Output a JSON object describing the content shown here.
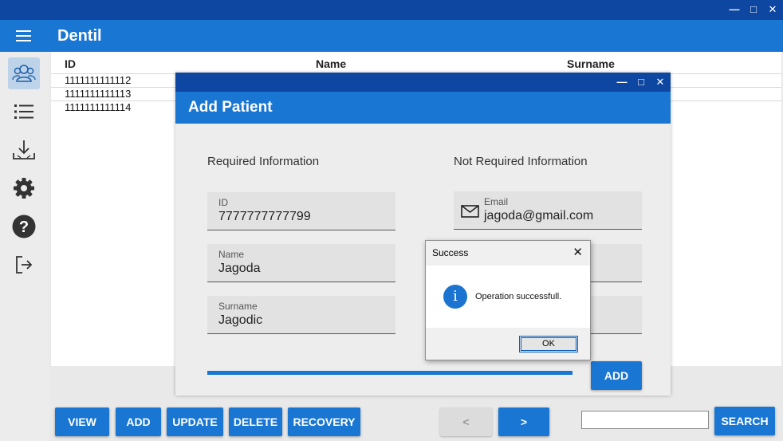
{
  "window": {
    "controls": {
      "minimize": "—",
      "maximize": "□",
      "close": "✕"
    }
  },
  "app": {
    "title": "Dentil"
  },
  "sidebar": {
    "items": [
      {
        "icon": "users-icon",
        "active": true
      },
      {
        "icon": "list-icon",
        "active": false
      },
      {
        "icon": "download-icon",
        "active": false
      },
      {
        "icon": "gear-icon",
        "active": false
      },
      {
        "icon": "help-icon",
        "active": false
      },
      {
        "icon": "logout-icon",
        "active": false
      }
    ]
  },
  "table": {
    "columns": [
      "ID",
      "Name",
      "Surname"
    ],
    "rows": [
      {
        "id": "1111111111112"
      },
      {
        "id": "1111111111113"
      },
      {
        "id": "1111111111114"
      }
    ]
  },
  "toolbar": {
    "view": "VIEW",
    "add": "ADD",
    "update": "UPDATE",
    "delete": "DELETE",
    "recovery": "RECOVERY",
    "prev": "<",
    "next": ">",
    "search_value": "",
    "search": "SEARCH"
  },
  "dialog": {
    "controls": {
      "minimize": "—",
      "maximize": "□",
      "close": "✕"
    },
    "title": "Add Patient",
    "required_title": "Required Information",
    "optional_title": "Not Required Information",
    "fields": {
      "id": {
        "label": "ID",
        "value": "7777777777799"
      },
      "name": {
        "label": "Name",
        "value": "Jagoda"
      },
      "surname": {
        "label": "Surname",
        "value": "Jagodic"
      },
      "email": {
        "label": "Email",
        "value": "jagoda@gmail.com"
      }
    },
    "add_button": "ADD"
  },
  "message_box": {
    "title": "Success",
    "close": "✕",
    "icon": "info-icon",
    "icon_glyph": "i",
    "text": "Operation successfull.",
    "ok": "OK"
  },
  "colors": {
    "primary": "#1976d2",
    "title_bar": "#0d47a1",
    "info": "#1b75d0"
  }
}
